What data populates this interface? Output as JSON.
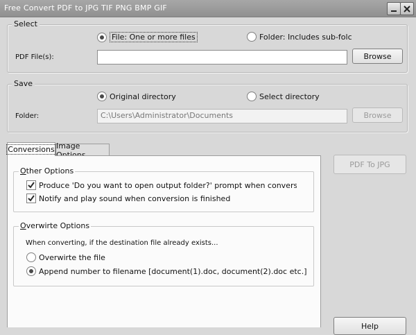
{
  "window": {
    "title": "Free Convert PDF to JPG TIF PNG BMP GIF"
  },
  "select": {
    "legend": "Select",
    "radio_file": "File:  One or more files",
    "radio_folder": "Folder: Includes sub-folc",
    "pdf_label": "PDF File(s):",
    "pdf_value": "",
    "browse_label": "Browse"
  },
  "save": {
    "legend": "Save",
    "radio_original": "Original directory",
    "radio_select": "Select directory",
    "folder_label": "Folder:",
    "folder_value": "C:\\Users\\Administrator\\Documents",
    "browse_label": "Browse"
  },
  "tabs": [
    {
      "label": "Conversions",
      "active": true
    },
    {
      "label": "Image Options",
      "active": false
    }
  ],
  "other_options": {
    "legend": "Other Options",
    "check1": "Produce 'Do you want to open output folder?' prompt when conversion is finis",
    "check2": "Notify and play sound when conversion is finished"
  },
  "overwrite_options": {
    "legend": "Overwirte Options",
    "info": "When converting, if the destination file already exists...",
    "radio_overwrite": "Overwirte the file",
    "radio_append": "Append number to filename  [document(1).doc, document(2).doc etc.]"
  },
  "actions": {
    "convert_label": "PDF To JPG",
    "help_label": "Help"
  }
}
